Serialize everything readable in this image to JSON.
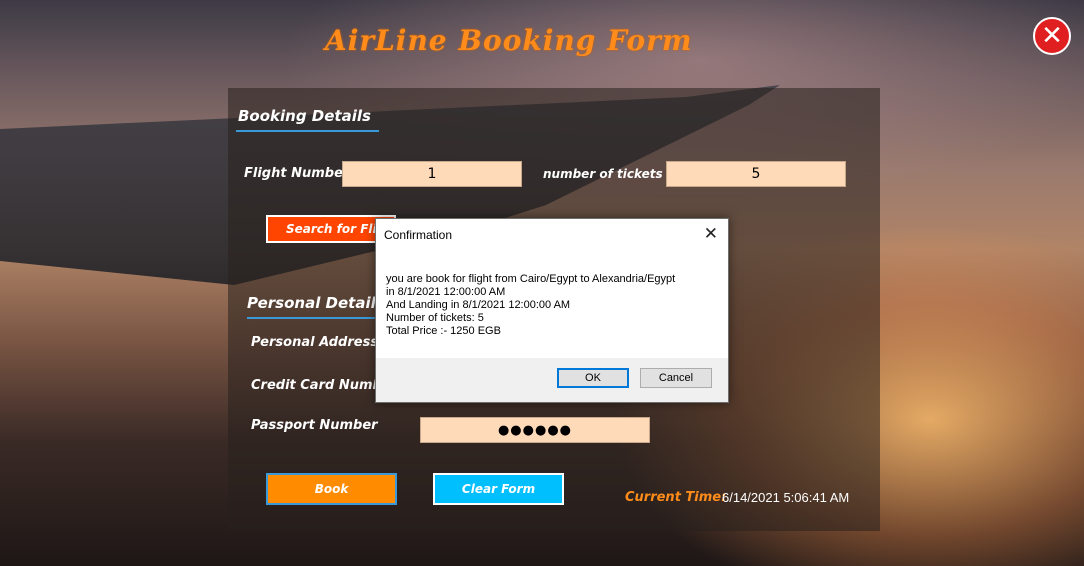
{
  "window": {
    "title": "AirLine Booking Form",
    "close_icon": "close-icon"
  },
  "booking": {
    "section_title": "Booking Details",
    "flight_number_label": "Flight Number",
    "flight_number_value": "1",
    "tickets_label": "number of tickets",
    "tickets_value": "5",
    "search_button": "Search for Flight"
  },
  "personal": {
    "section_title": "Personal Details",
    "address_label": "Personal Address",
    "credit_card_label": "Credit Card Number",
    "passport_label": "Passport Number",
    "passport_value": "●●●●●●"
  },
  "actions": {
    "book_button": "Book",
    "clear_button": "Clear Form",
    "current_time_label": "Current Time:",
    "current_time_value": "6/14/2021 5:06:41 AM"
  },
  "dialog": {
    "title": "Confirmation",
    "close_glyph": "✕",
    "lines": [
      "you are book for flight from Cairo/Egypt to Alexandria/Egypt",
      "in 8/1/2021 12:00:00 AM",
      "And Landing in 8/1/2021 12:00:00 AM",
      "Number of tickets: 5",
      "Total Price :-  1250 EGB"
    ],
    "ok_button": "OK",
    "cancel_button": "Cancel"
  },
  "colors": {
    "title": "#ff8c1a",
    "field_bg": "#ffdab9",
    "search_button": "#ff4500",
    "book_button": "#ff8c00",
    "clear_button": "#00bfff",
    "section_underline": "#3a9ad9",
    "time_label": "#ff8c1a"
  }
}
